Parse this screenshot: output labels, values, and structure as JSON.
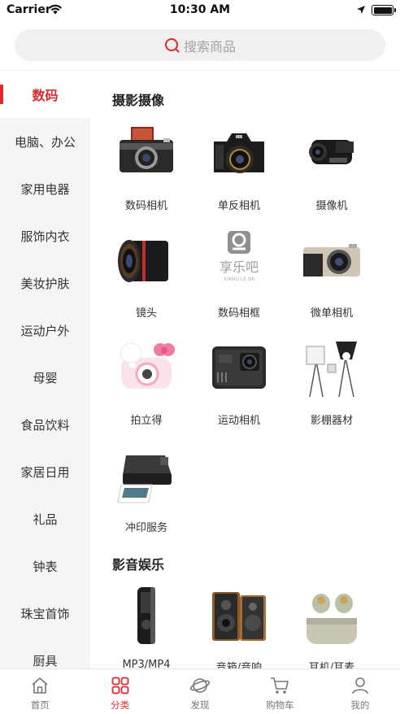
{
  "status_bar": {
    "carrier": "Carrier",
    "time": "10:30 AM",
    "battery_level": 1.0
  },
  "search": {
    "placeholder": "搜索商品"
  },
  "sidebar": {
    "items": [
      {
        "label": "数码",
        "active": true
      },
      {
        "label": "电脑、办公",
        "active": false
      },
      {
        "label": "家用电器",
        "active": false
      },
      {
        "label": "服饰内衣",
        "active": false
      },
      {
        "label": "美妆护肤",
        "active": false
      },
      {
        "label": "运动户外",
        "active": false
      },
      {
        "label": "母婴",
        "active": false
      },
      {
        "label": "食品饮料",
        "active": false
      },
      {
        "label": "家居日用",
        "active": false
      },
      {
        "label": "礼品",
        "active": false
      },
      {
        "label": "钟表",
        "active": false
      },
      {
        "label": "珠宝首饰",
        "active": false
      },
      {
        "label": "厨具",
        "active": false
      }
    ]
  },
  "sections": [
    {
      "title": "摄影摄像",
      "items": [
        {
          "label": "数码相机",
          "icon": "digital-camera-image"
        },
        {
          "label": "单反相机",
          "icon": "dslr-camera-image"
        },
        {
          "label": "摄像机",
          "icon": "camcorder-image"
        },
        {
          "label": "镜头",
          "icon": "lens-image"
        },
        {
          "label": "数码相框",
          "icon": "xiangleba-logo-image"
        },
        {
          "label": "微单相机",
          "icon": "mirrorless-camera-image"
        },
        {
          "label": "拍立得",
          "icon": "instant-camera-image"
        },
        {
          "label": "运动相机",
          "icon": "action-camera-image"
        },
        {
          "label": "影棚器材",
          "icon": "studio-lights-image"
        },
        {
          "label": "冲印服务",
          "icon": "photo-printer-image"
        }
      ]
    },
    {
      "title": "影音娱乐",
      "items": [
        {
          "label": "MP3/MP4",
          "icon": "mp3-player-image"
        },
        {
          "label": "音箱/音响",
          "icon": "speakers-image"
        },
        {
          "label": "耳机/耳麦",
          "icon": "earbuds-image"
        }
      ]
    }
  ],
  "logo": {
    "text": "享乐吧",
    "subtext": "XIANG LE BA"
  },
  "tabbar": {
    "items": [
      {
        "label": "首页",
        "icon": "home-icon",
        "active": false
      },
      {
        "label": "分类",
        "icon": "category-icon",
        "active": true
      },
      {
        "label": "发现",
        "icon": "planet-icon",
        "active": false
      },
      {
        "label": "购物车",
        "icon": "cart-icon",
        "active": false
      },
      {
        "label": "我的",
        "icon": "user-icon",
        "active": false
      }
    ]
  },
  "colors": {
    "accent": "#e0292d",
    "sidebar_bg": "#f5f5f5",
    "search_bg": "#f0f0f0",
    "tab_inactive": "#777777"
  }
}
